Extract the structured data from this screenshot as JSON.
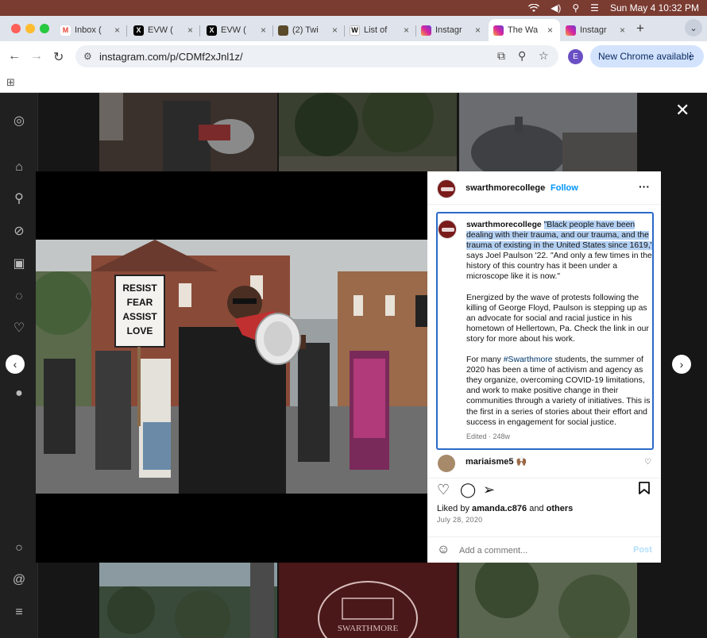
{
  "menubar": {
    "date_time": "Sun May 4  10:32 PM"
  },
  "browser": {
    "tabs": [
      {
        "label": "Inbox (",
        "favicon": "gmail-icon",
        "color": "#ea4335",
        "glyph": "M"
      },
      {
        "label": "EVW (",
        "favicon": "x-icon",
        "color": "#000000",
        "glyph": "X"
      },
      {
        "label": "EVW (",
        "favicon": "x-icon",
        "color": "#000000",
        "glyph": "X"
      },
      {
        "label": "(2) Twi",
        "favicon": "twitch-avatar-icon",
        "color": "#5a4a2a",
        "glyph": ""
      },
      {
        "label": "List of",
        "favicon": "wikipedia-icon",
        "color": "#ffffff",
        "glyph": "W"
      },
      {
        "label": "Instagr",
        "favicon": "instagram-icon",
        "color": "#d6249f",
        "glyph": ""
      },
      {
        "label": "The Wa",
        "favicon": "instagram-icon",
        "color": "#d6249f",
        "glyph": "",
        "active": true
      },
      {
        "label": "Instagr",
        "favicon": "instagram-icon",
        "color": "#d6249f",
        "glyph": ""
      }
    ],
    "url": "instagram.com/p/CDMf2xJnl1z/",
    "profile_initial": "E",
    "new_chrome_label": "New Chrome available"
  },
  "post": {
    "username": "swarthmorecollege",
    "follow_label": "Follow",
    "caption": {
      "quote": "\"Black people have been dealing with their trauma, and our trauma, and the trauma of existing in the United States since 1619,\"",
      "p1_rest": " says Joel Paulson '22. \"And only a few times in the history of this country has it been under a microscope like it is now.\"",
      "p2": "Energized by the wave of protests following the killing of George Floyd, Paulson is stepping up as an advocate for social and racial justice in his hometown of Hellertown, Pa. Check the link in our story for more about his work.",
      "p3_pre": "For many ",
      "hashtag": "#Swarthmore",
      "p3_rest": " students, the summer of 2020 has been a time of activism and agency as they organize, overcoming COVID-19 limitations, and work to make positive change in their communities through a variety of initiatives. This is the first in a series of stories about their effort and success in engagement for social justice.",
      "edited": "Edited · 248w"
    },
    "comment": {
      "username": "mariaisme5 🙌🏾"
    },
    "liked_by_prefix": "Liked by ",
    "liked_by_user": "amanda.c876",
    "liked_by_and": " and ",
    "liked_by_others": "others",
    "date": "July 28, 2020",
    "add_comment_placeholder": "Add a comment...",
    "post_label": "Post"
  },
  "sign": {
    "line1": "RESIST",
    "line2": "FEAR",
    "line3": "ASSIST",
    "line4": "LOVE"
  },
  "tiles": {
    "bottom_center_label": "SWARTHMORE"
  },
  "colors": {
    "menubar": "#7a3b31",
    "accent": "#0095f6",
    "caption_border": "#2a6ac8",
    "highlight": "#b4d1f3"
  }
}
